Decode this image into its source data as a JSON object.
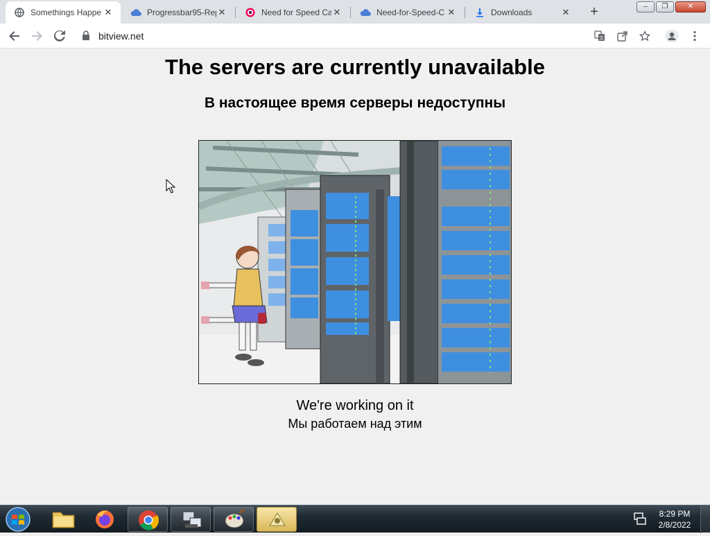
{
  "browser": {
    "tabs": [
      {
        "title": "Somethings Happe",
        "favicon": "globe-icon",
        "active": true
      },
      {
        "title": "Progressbar95-Rep",
        "favicon": "cloud-icon",
        "active": false
      },
      {
        "title": "Need for Speed Ca",
        "favicon": "fandom-icon",
        "active": false
      },
      {
        "title": "Need-for-Speed-C",
        "favicon": "cloud-icon",
        "active": false
      },
      {
        "title": "Downloads",
        "favicon": "download-icon",
        "active": false
      }
    ],
    "url": "bitview.net"
  },
  "page": {
    "heading_en": "The servers are currently unavailable",
    "heading_ru": "В настоящее время серверы недоступны",
    "message_en": "We're working on it",
    "message_ru": "Мы работаем над этим"
  },
  "taskbar": {
    "pinned": [
      "folder-icon",
      "firefox-icon",
      "chrome-icon",
      "network-icon",
      "paint-icon",
      "app-icon"
    ],
    "clock_time": "8:29 PM",
    "clock_date": "2/8/2022"
  },
  "colors": {
    "accent_blue": "#1a73e8",
    "page_background": "#f0f0f0",
    "server_blue": "#3f8fe0"
  }
}
